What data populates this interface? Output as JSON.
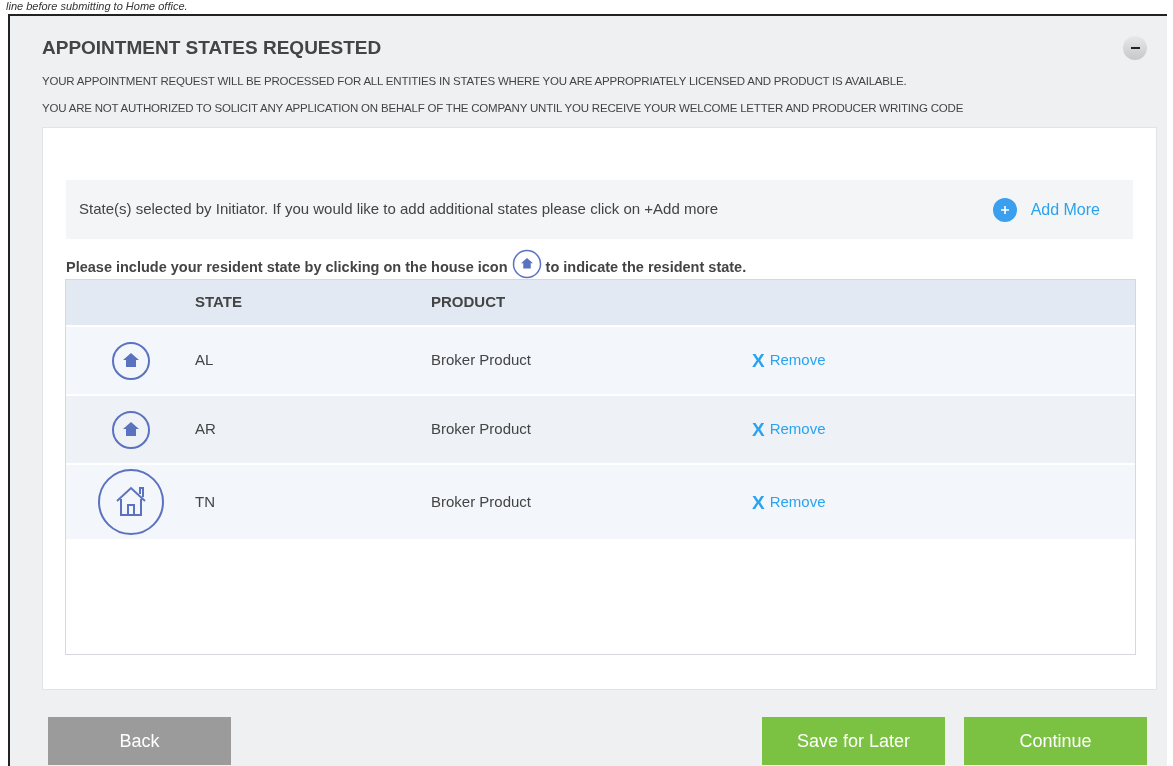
{
  "top_note": "line before submitting to Home office.",
  "section": {
    "title": "APPOINTMENT STATES REQUESTED",
    "notices": [
      "YOUR APPOINTMENT REQUEST WILL BE PROCESSED FOR ALL ENTITIES IN STATES WHERE YOU ARE APPROPRIATELY LICENSED AND PRODUCT IS AVAILABLE.",
      "YOU ARE NOT AUTHORIZED TO SOLICIT ANY APPLICATION ON BEHALF OF THE COMPANY UNTIL YOU RECEIVE YOUR WELCOME LETTER AND PRODUCER WRITING CODE"
    ]
  },
  "info_bar": {
    "text": "State(s) selected by Initiator. If you would like to add additional states please click on +Add more",
    "action": "Add More"
  },
  "instruction": {
    "before": "Please include your resident state by clicking on the house icon",
    "after": "to indicate the resident state."
  },
  "table": {
    "columns": [
      "STATE",
      "PRODUCT"
    ],
    "rows": [
      {
        "state": "AL",
        "product": "Broker Product",
        "remove_icon": "X",
        "remove": "Remove",
        "resident": false
      },
      {
        "state": "AR",
        "product": "Broker Product",
        "remove_icon": "X",
        "remove": "Remove",
        "resident": false
      },
      {
        "state": "TN",
        "product": "Broker Product",
        "remove_icon": "X",
        "remove": "Remove",
        "resident": true
      }
    ]
  },
  "buttons": {
    "back": "Back",
    "save": "Save for Later",
    "continue": "Continue"
  }
}
